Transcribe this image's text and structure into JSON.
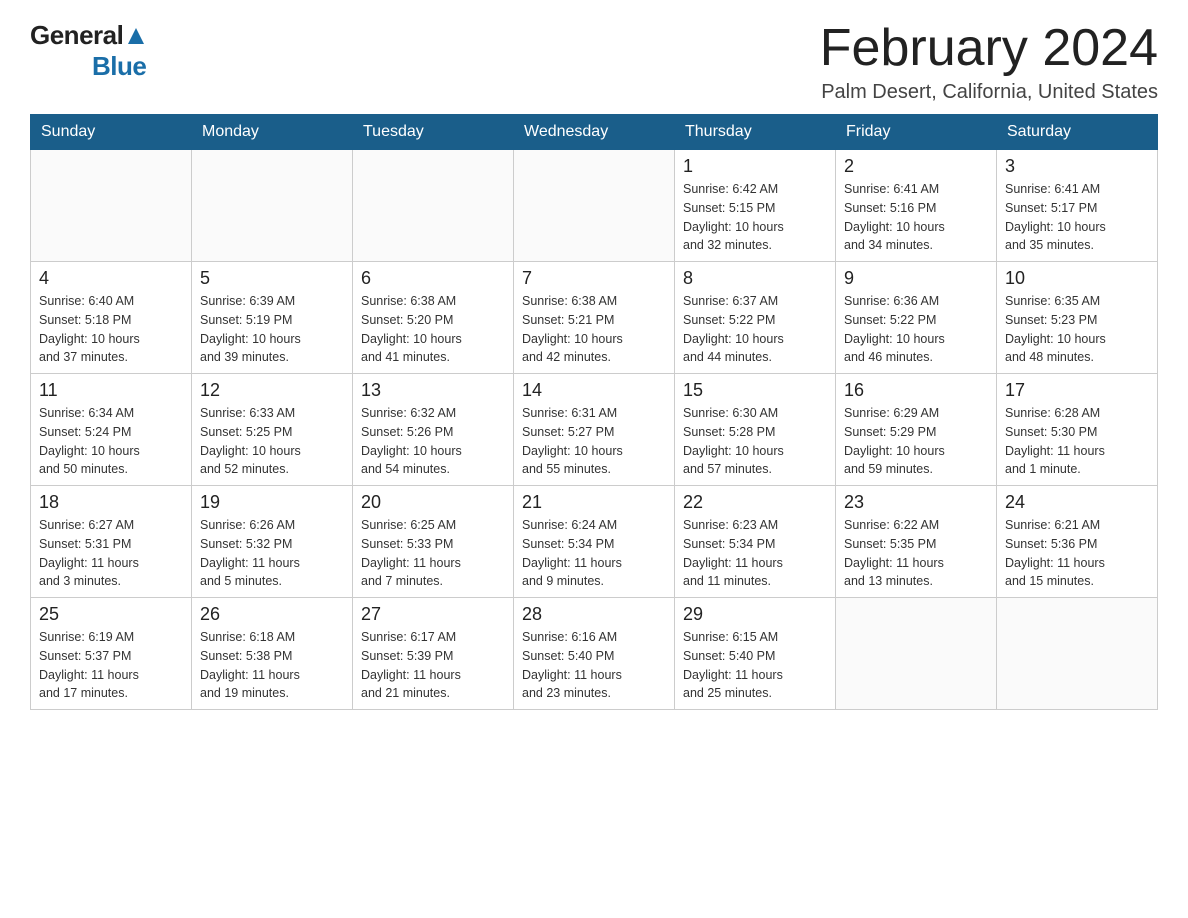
{
  "logo": {
    "text_general": "General",
    "text_blue": "Blue",
    "triangle": "▲"
  },
  "title": {
    "month_year": "February 2024",
    "location": "Palm Desert, California, United States"
  },
  "headers": [
    "Sunday",
    "Monday",
    "Tuesday",
    "Wednesday",
    "Thursday",
    "Friday",
    "Saturday"
  ],
  "weeks": [
    [
      {
        "day": "",
        "info": ""
      },
      {
        "day": "",
        "info": ""
      },
      {
        "day": "",
        "info": ""
      },
      {
        "day": "",
        "info": ""
      },
      {
        "day": "1",
        "info": "Sunrise: 6:42 AM\nSunset: 5:15 PM\nDaylight: 10 hours\nand 32 minutes."
      },
      {
        "day": "2",
        "info": "Sunrise: 6:41 AM\nSunset: 5:16 PM\nDaylight: 10 hours\nand 34 minutes."
      },
      {
        "day": "3",
        "info": "Sunrise: 6:41 AM\nSunset: 5:17 PM\nDaylight: 10 hours\nand 35 minutes."
      }
    ],
    [
      {
        "day": "4",
        "info": "Sunrise: 6:40 AM\nSunset: 5:18 PM\nDaylight: 10 hours\nand 37 minutes."
      },
      {
        "day": "5",
        "info": "Sunrise: 6:39 AM\nSunset: 5:19 PM\nDaylight: 10 hours\nand 39 minutes."
      },
      {
        "day": "6",
        "info": "Sunrise: 6:38 AM\nSunset: 5:20 PM\nDaylight: 10 hours\nand 41 minutes."
      },
      {
        "day": "7",
        "info": "Sunrise: 6:38 AM\nSunset: 5:21 PM\nDaylight: 10 hours\nand 42 minutes."
      },
      {
        "day": "8",
        "info": "Sunrise: 6:37 AM\nSunset: 5:22 PM\nDaylight: 10 hours\nand 44 minutes."
      },
      {
        "day": "9",
        "info": "Sunrise: 6:36 AM\nSunset: 5:22 PM\nDaylight: 10 hours\nand 46 minutes."
      },
      {
        "day": "10",
        "info": "Sunrise: 6:35 AM\nSunset: 5:23 PM\nDaylight: 10 hours\nand 48 minutes."
      }
    ],
    [
      {
        "day": "11",
        "info": "Sunrise: 6:34 AM\nSunset: 5:24 PM\nDaylight: 10 hours\nand 50 minutes."
      },
      {
        "day": "12",
        "info": "Sunrise: 6:33 AM\nSunset: 5:25 PM\nDaylight: 10 hours\nand 52 minutes."
      },
      {
        "day": "13",
        "info": "Sunrise: 6:32 AM\nSunset: 5:26 PM\nDaylight: 10 hours\nand 54 minutes."
      },
      {
        "day": "14",
        "info": "Sunrise: 6:31 AM\nSunset: 5:27 PM\nDaylight: 10 hours\nand 55 minutes."
      },
      {
        "day": "15",
        "info": "Sunrise: 6:30 AM\nSunset: 5:28 PM\nDaylight: 10 hours\nand 57 minutes."
      },
      {
        "day": "16",
        "info": "Sunrise: 6:29 AM\nSunset: 5:29 PM\nDaylight: 10 hours\nand 59 minutes."
      },
      {
        "day": "17",
        "info": "Sunrise: 6:28 AM\nSunset: 5:30 PM\nDaylight: 11 hours\nand 1 minute."
      }
    ],
    [
      {
        "day": "18",
        "info": "Sunrise: 6:27 AM\nSunset: 5:31 PM\nDaylight: 11 hours\nand 3 minutes."
      },
      {
        "day": "19",
        "info": "Sunrise: 6:26 AM\nSunset: 5:32 PM\nDaylight: 11 hours\nand 5 minutes."
      },
      {
        "day": "20",
        "info": "Sunrise: 6:25 AM\nSunset: 5:33 PM\nDaylight: 11 hours\nand 7 minutes."
      },
      {
        "day": "21",
        "info": "Sunrise: 6:24 AM\nSunset: 5:34 PM\nDaylight: 11 hours\nand 9 minutes."
      },
      {
        "day": "22",
        "info": "Sunrise: 6:23 AM\nSunset: 5:34 PM\nDaylight: 11 hours\nand 11 minutes."
      },
      {
        "day": "23",
        "info": "Sunrise: 6:22 AM\nSunset: 5:35 PM\nDaylight: 11 hours\nand 13 minutes."
      },
      {
        "day": "24",
        "info": "Sunrise: 6:21 AM\nSunset: 5:36 PM\nDaylight: 11 hours\nand 15 minutes."
      }
    ],
    [
      {
        "day": "25",
        "info": "Sunrise: 6:19 AM\nSunset: 5:37 PM\nDaylight: 11 hours\nand 17 minutes."
      },
      {
        "day": "26",
        "info": "Sunrise: 6:18 AM\nSunset: 5:38 PM\nDaylight: 11 hours\nand 19 minutes."
      },
      {
        "day": "27",
        "info": "Sunrise: 6:17 AM\nSunset: 5:39 PM\nDaylight: 11 hours\nand 21 minutes."
      },
      {
        "day": "28",
        "info": "Sunrise: 6:16 AM\nSunset: 5:40 PM\nDaylight: 11 hours\nand 23 minutes."
      },
      {
        "day": "29",
        "info": "Sunrise: 6:15 AM\nSunset: 5:40 PM\nDaylight: 11 hours\nand 25 minutes."
      },
      {
        "day": "",
        "info": ""
      },
      {
        "day": "",
        "info": ""
      }
    ]
  ]
}
